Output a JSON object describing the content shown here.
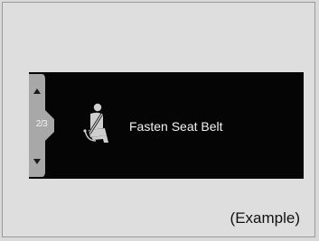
{
  "pager": {
    "indicator": "2/3",
    "up_icon": "triangle-up",
    "down_icon": "triangle-down"
  },
  "warning": {
    "icon": "seat-belt-icon",
    "message": "Fasten Seat Belt"
  },
  "caption": "(Example)",
  "colors": {
    "display": "#050505",
    "text": "#f2f2f2",
    "pager": "#a8a8a8",
    "background": "#d9d9d9"
  }
}
